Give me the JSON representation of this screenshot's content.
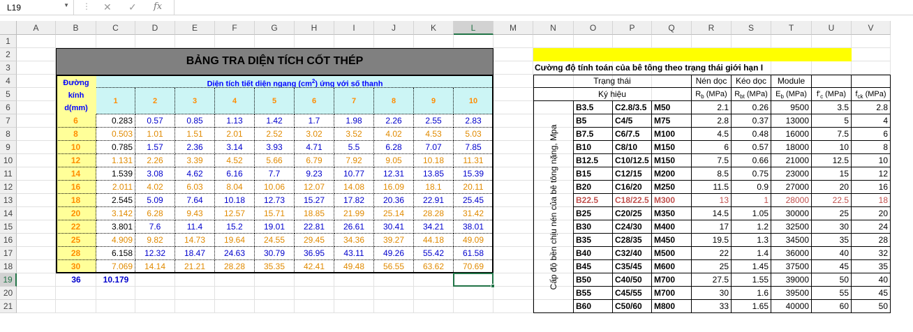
{
  "formula_bar": {
    "cell_ref": "L19",
    "cancel_icon": "cancel-icon",
    "enter_icon": "check-icon",
    "fx_label": "fx"
  },
  "columns": [
    "A",
    "B",
    "C",
    "D",
    "E",
    "F",
    "G",
    "H",
    "I",
    "J",
    "K",
    "L",
    "M",
    "N",
    "O",
    "P",
    "Q",
    "R",
    "S",
    "T",
    "U",
    "V"
  ],
  "rows": [
    "1",
    "2",
    "3",
    "4",
    "5",
    "6",
    "7",
    "8",
    "9",
    "10",
    "11",
    "12",
    "13",
    "14",
    "15",
    "16",
    "17",
    "18",
    "19",
    "20",
    "21"
  ],
  "selected_column": "L",
  "selected_row": "19",
  "steel": {
    "title": "BẢNG TRA DIỆN TÍCH CỐT THÉP",
    "diam_label": [
      "Đường",
      "kính",
      "d(mm)"
    ],
    "header_prefix": "Diện tích tiết diện ngang (cm",
    "header_sup": "2",
    "header_suffix": ") ứng với số thanh",
    "counts": [
      "1",
      "2",
      "3",
      "4",
      "5",
      "6",
      "7",
      "8",
      "9",
      "10"
    ],
    "rows": [
      {
        "d": "6",
        "v": [
          "0.283",
          "0.57",
          "0.85",
          "1.13",
          "1.42",
          "1.7",
          "1.98",
          "2.26",
          "2.55",
          "2.83"
        ]
      },
      {
        "d": "8",
        "v": [
          "0.503",
          "1.01",
          "1.51",
          "2.01",
          "2.52",
          "3.02",
          "3.52",
          "4.02",
          "4.53",
          "5.03"
        ]
      },
      {
        "d": "10",
        "v": [
          "0.785",
          "1.57",
          "2.36",
          "3.14",
          "3.93",
          "4.71",
          "5.5",
          "6.28",
          "7.07",
          "7.85"
        ]
      },
      {
        "d": "12",
        "v": [
          "1.131",
          "2.26",
          "3.39",
          "4.52",
          "5.66",
          "6.79",
          "7.92",
          "9.05",
          "10.18",
          "11.31"
        ]
      },
      {
        "d": "14",
        "v": [
          "1.539",
          "3.08",
          "4.62",
          "6.16",
          "7.7",
          "9.23",
          "10.77",
          "12.31",
          "13.85",
          "15.39"
        ]
      },
      {
        "d": "16",
        "v": [
          "2.011",
          "4.02",
          "6.03",
          "8.04",
          "10.06",
          "12.07",
          "14.08",
          "16.09",
          "18.1",
          "20.11"
        ]
      },
      {
        "d": "18",
        "v": [
          "2.545",
          "5.09",
          "7.64",
          "10.18",
          "12.73",
          "15.27",
          "17.82",
          "20.36",
          "22.91",
          "25.45"
        ]
      },
      {
        "d": "20",
        "v": [
          "3.142",
          "6.28",
          "9.43",
          "12.57",
          "15.71",
          "18.85",
          "21.99",
          "25.14",
          "28.28",
          "31.42"
        ]
      },
      {
        "d": "22",
        "v": [
          "3.801",
          "7.6",
          "11.4",
          "15.2",
          "19.01",
          "22.81",
          "26.61",
          "30.41",
          "34.21",
          "38.01"
        ]
      },
      {
        "d": "25",
        "v": [
          "4.909",
          "9.82",
          "14.73",
          "19.64",
          "24.55",
          "29.45",
          "34.36",
          "39.27",
          "44.18",
          "49.09"
        ]
      },
      {
        "d": "28",
        "v": [
          "6.158",
          "12.32",
          "18.47",
          "24.63",
          "30.79",
          "36.95",
          "43.11",
          "49.26",
          "55.42",
          "61.58"
        ]
      },
      {
        "d": "30",
        "v": [
          "7.069",
          "14.14",
          "21.21",
          "28.28",
          "35.35",
          "42.41",
          "49.48",
          "56.55",
          "63.62",
          "70.69"
        ]
      }
    ],
    "extra_d": "36",
    "extra_v": "10.179"
  },
  "concrete": {
    "title": "Cường độ tính toán của bê tông theo trạng thái giới hạn I",
    "state_label": "Trạng thái",
    "symbol_label": "Ký hiệu",
    "h_nen": "Nén dọc",
    "h_keo": "Kéo dọc",
    "h_module": "Module",
    "u_rb": "R",
    "u_rb_sub": "b",
    "u_rb_unit": " (MPa)",
    "u_rbt": "R",
    "u_rbt_sub": "bt",
    "u_rbt_unit": " (MPa)",
    "u_eb": "E",
    "u_eb_sub": "b",
    "u_eb_unit": " (MPa)",
    "u_fc": "f'",
    "u_fc_sub": "c",
    "u_fc_unit": " (MPa)",
    "u_fck": "f",
    "u_fck_sub": "ck",
    "u_fck_unit": " (MPa)",
    "vertical_label": "Cấp độ bền chịu nén của bê tông nặng,  Mpa",
    "highlight_row": 7,
    "rows": [
      [
        "B3.5",
        "C2.8/3.5",
        "M50",
        "2.1",
        "0.26",
        "9500",
        "3.5",
        "2.8"
      ],
      [
        "B5",
        "C4/5",
        "M75",
        "2.8",
        "0.37",
        "13000",
        "5",
        "4"
      ],
      [
        "B7.5",
        "C6/7.5",
        "M100",
        "4.5",
        "0.48",
        "16000",
        "7.5",
        "6"
      ],
      [
        "B10",
        "C8/10",
        "M150",
        "6",
        "0.57",
        "18000",
        "10",
        "8"
      ],
      [
        "B12.5",
        "C10/12.5",
        "M150",
        "7.5",
        "0.66",
        "21000",
        "12.5",
        "10"
      ],
      [
        "B15",
        "C12/15",
        "M200",
        "8.5",
        "0.75",
        "23000",
        "15",
        "12"
      ],
      [
        "B20",
        "C16/20",
        "M250",
        "11.5",
        "0.9",
        "27000",
        "20",
        "16"
      ],
      [
        "B22.5",
        "C18/22.5",
        "M300",
        "13",
        "1",
        "28000",
        "22.5",
        "18"
      ],
      [
        "B25",
        "C20/25",
        "M350",
        "14.5",
        "1.05",
        "30000",
        "25",
        "20"
      ],
      [
        "B30",
        "C24/30",
        "M400",
        "17",
        "1.2",
        "32500",
        "30",
        "24"
      ],
      [
        "B35",
        "C28/35",
        "M450",
        "19.5",
        "1.3",
        "34500",
        "35",
        "28"
      ],
      [
        "B40",
        "C32/40",
        "M500",
        "22",
        "1.4",
        "36000",
        "40",
        "32"
      ],
      [
        "B45",
        "C35/45",
        "M600",
        "25",
        "1.45",
        "37500",
        "45",
        "35"
      ],
      [
        "B50",
        "C40/50",
        "M700",
        "27.5",
        "1.55",
        "39000",
        "50",
        "40"
      ],
      [
        "B55",
        "C45/55",
        "M700",
        "30",
        "1.6",
        "39500",
        "55",
        "45"
      ],
      [
        "B60",
        "C50/60",
        "M800",
        "33",
        "1.65",
        "40000",
        "60",
        "50"
      ]
    ]
  },
  "colors": {
    "title_bg": "#808080",
    "header_bg": "#ccf5f5",
    "diam_bg": "#ffff99",
    "yellow_band": "#ffff00",
    "highlight": "#c0504d",
    "select": "#217346"
  }
}
